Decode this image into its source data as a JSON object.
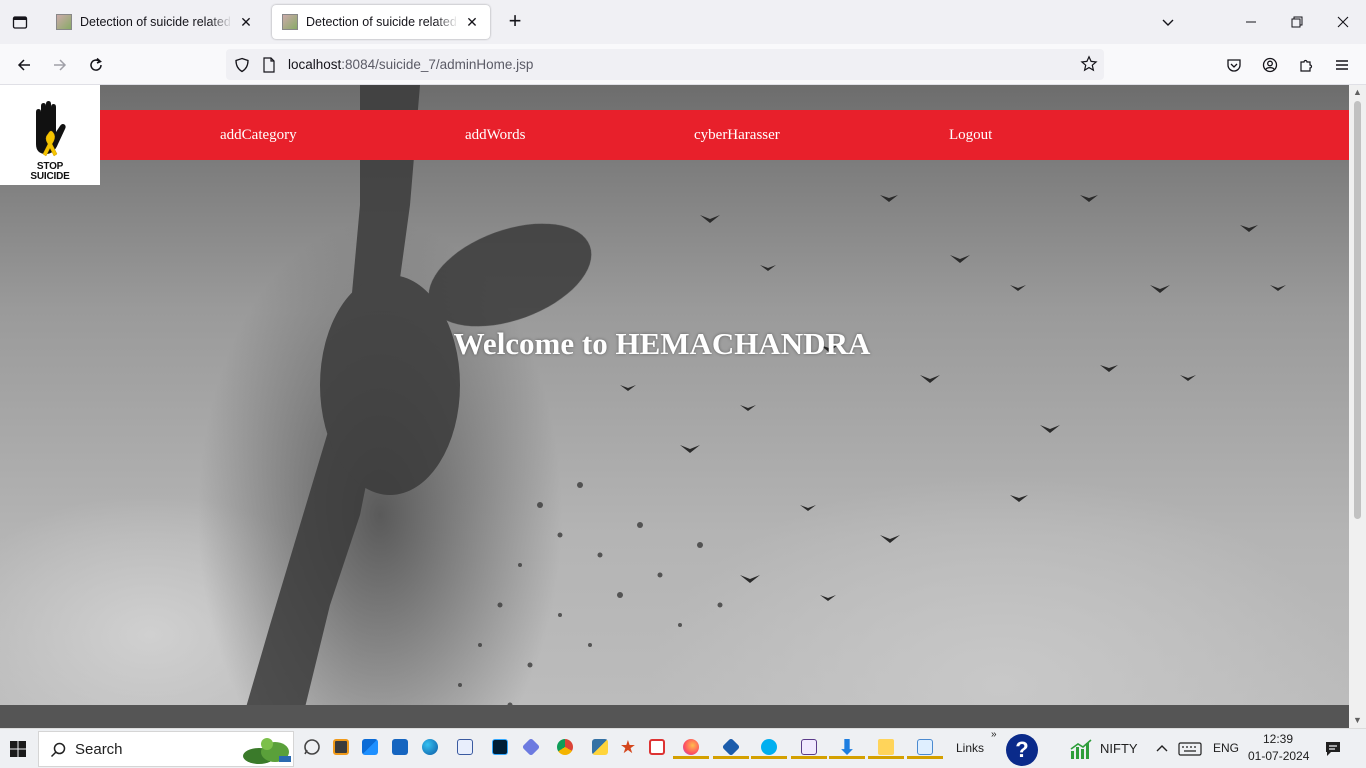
{
  "browser": {
    "tabs": [
      {
        "title": "Detection of suicide related pos",
        "active": false
      },
      {
        "title": "Detection of suicide related pos",
        "active": true
      }
    ],
    "url_host": "localhost",
    "url_rest": ":8084/suicide_7/adminHome.jsp"
  },
  "page": {
    "logo_text_line1": "STOP",
    "logo_text_line2": "SUICIDE",
    "menu": [
      {
        "label": "addCategory"
      },
      {
        "label": "addWords"
      },
      {
        "label": "cyberHarasser"
      },
      {
        "label": "Logout"
      }
    ],
    "welcome": "Welcome to HEMACHANDRA"
  },
  "taskbar": {
    "search_label": "Search",
    "links_label": "Links",
    "nifty_label": "NIFTY",
    "language": "ENG",
    "time": "12:39",
    "date": "01-07-2024"
  },
  "colors": {
    "menu_bg": "#e8202b",
    "menu_text": "#ffffff"
  }
}
